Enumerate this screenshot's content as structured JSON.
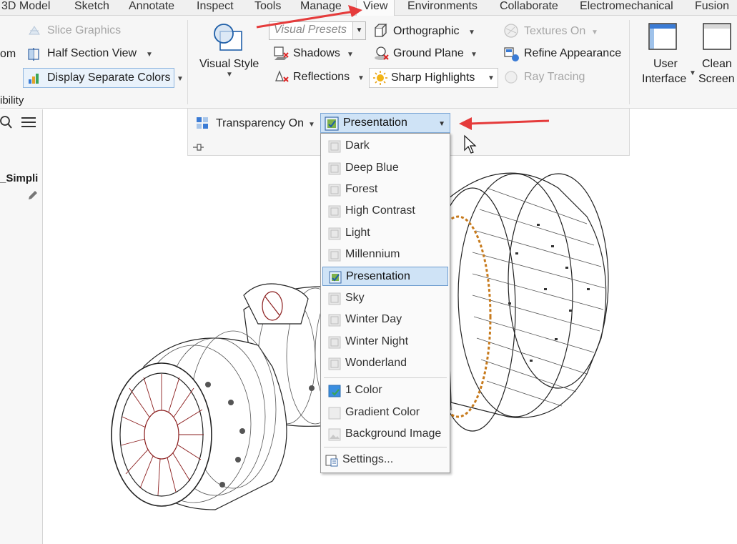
{
  "tabs": [
    "3D Model",
    "Sketch",
    "Annotate",
    "Inspect",
    "Tools",
    "Manage",
    "View",
    "Environments",
    "Collaborate",
    "Electromechanical",
    "Fusion"
  ],
  "active_tab": "View",
  "ribbon": {
    "left_partial": {
      "zoom_fragment": "om",
      "visibility_fragment": "ibility"
    },
    "slice_graphics": "Slice Graphics",
    "half_section_view": "Half Section View",
    "display_separate_colors": "Display Separate Colors",
    "visual_style": "Visual Style",
    "visual_presets": "Visual Presets",
    "shadows": "Shadows",
    "reflections": "Reflections",
    "orthographic": "Orthographic",
    "ground_plane": "Ground Plane",
    "sharp_highlights": "Sharp Highlights",
    "textures_on": "Textures On",
    "refine_appearance": "Refine Appearance",
    "ray_tracing": "Ray Tracing",
    "user_interface_line1": "User",
    "user_interface_line2": "Interface",
    "clean_screen_line1": "Clean",
    "clean_screen_line2": "Screen",
    "transparency_on": "Transparency On"
  },
  "left_panel": {
    "model_name_fragment": "_Simpli"
  },
  "dropdown": {
    "current": "Presentation",
    "items": [
      "Dark",
      "Deep Blue",
      "Forest",
      "High Contrast",
      "Light",
      "Millennium",
      "Presentation",
      "Sky",
      "Winter Day",
      "Winter Night",
      "Wonderland"
    ],
    "selected": "Presentation",
    "background_options": [
      "1 Color",
      "Gradient Color",
      "Background Image"
    ],
    "settings": "Settings..."
  },
  "colors": {
    "annotation_arrow": "#e53b3b",
    "selection_fill": "#cfe3f6",
    "selection_border": "#6d9ccf"
  }
}
